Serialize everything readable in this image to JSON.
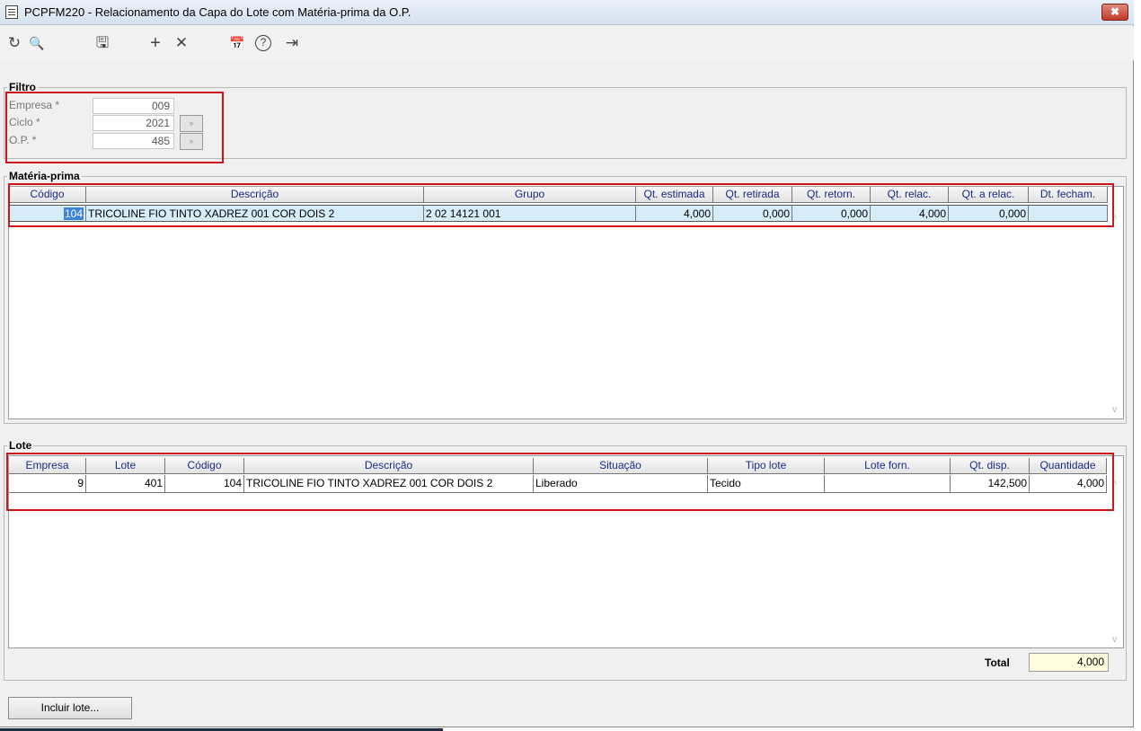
{
  "window": {
    "title": "PCPFM220 - Relacionamento da Capa do Lote com Matéria-prima da O.P.",
    "close_glyph": "✖"
  },
  "toolbar": [
    {
      "name": "refresh-icon",
      "glyph": "↻"
    },
    {
      "name": "search-icon",
      "glyph": "🔍"
    },
    {
      "name": "save-icon",
      "glyph": "🖫"
    },
    {
      "name": "add-icon",
      "glyph": "+"
    },
    {
      "name": "delete-icon",
      "glyph": "✕"
    },
    {
      "name": "calendar-icon",
      "glyph": "📅"
    },
    {
      "name": "help-icon",
      "glyph": "?"
    },
    {
      "name": "exit-icon",
      "glyph": "⇥"
    }
  ],
  "filtro": {
    "legend": "Filtro",
    "empresa_label": "Empresa *",
    "empresa_value": "009",
    "ciclo_label": "Ciclo *",
    "ciclo_value": "2021",
    "op_label": "O.P. *",
    "op_value": "485",
    "lookup_glyph": "»"
  },
  "materia": {
    "legend": "Matéria-prima",
    "headers": [
      "Código",
      "Descrição",
      "Grupo",
      "Qt. estimada",
      "Qt. retirada",
      "Qt. retorn.",
      "Qt. relac.",
      "Qt. a relac.",
      "Dt. fecham."
    ],
    "row": {
      "codigo": "104",
      "descricao": "TRICOLINE FIO TINTO XADREZ 001 COR DOIS 2",
      "grupo": "2 02 14121 001",
      "qt_estimada": "4,000",
      "qt_retirada": "0,000",
      "qt_retorn": "0,000",
      "qt_relac": "4,000",
      "qt_a_relac": "0,000",
      "dt_fecham": ""
    }
  },
  "lote": {
    "legend": "Lote",
    "headers": [
      "Empresa",
      "Lote",
      "Código",
      "Descrição",
      "Situação",
      "Tipo lote",
      "Lote forn.",
      "Qt. disp.",
      "Quantidade"
    ],
    "row": {
      "empresa": "9",
      "lote": "401",
      "codigo": "104",
      "descricao": "TRICOLINE FIO TINTO XADREZ 001 COR DOIS 2",
      "situacao": "Liberado",
      "tipo_lote": "Tecido",
      "lote_forn": "",
      "qt_disp": "142,500",
      "quantidade": "4,000"
    },
    "total_label": "Total",
    "total_value": "4,000"
  },
  "actions": {
    "incluir_lote": "Incluir lote..."
  },
  "colors": {
    "highlight": "#d0141c",
    "selection": "#3d84d8",
    "header_text": "#1a2a8a"
  }
}
